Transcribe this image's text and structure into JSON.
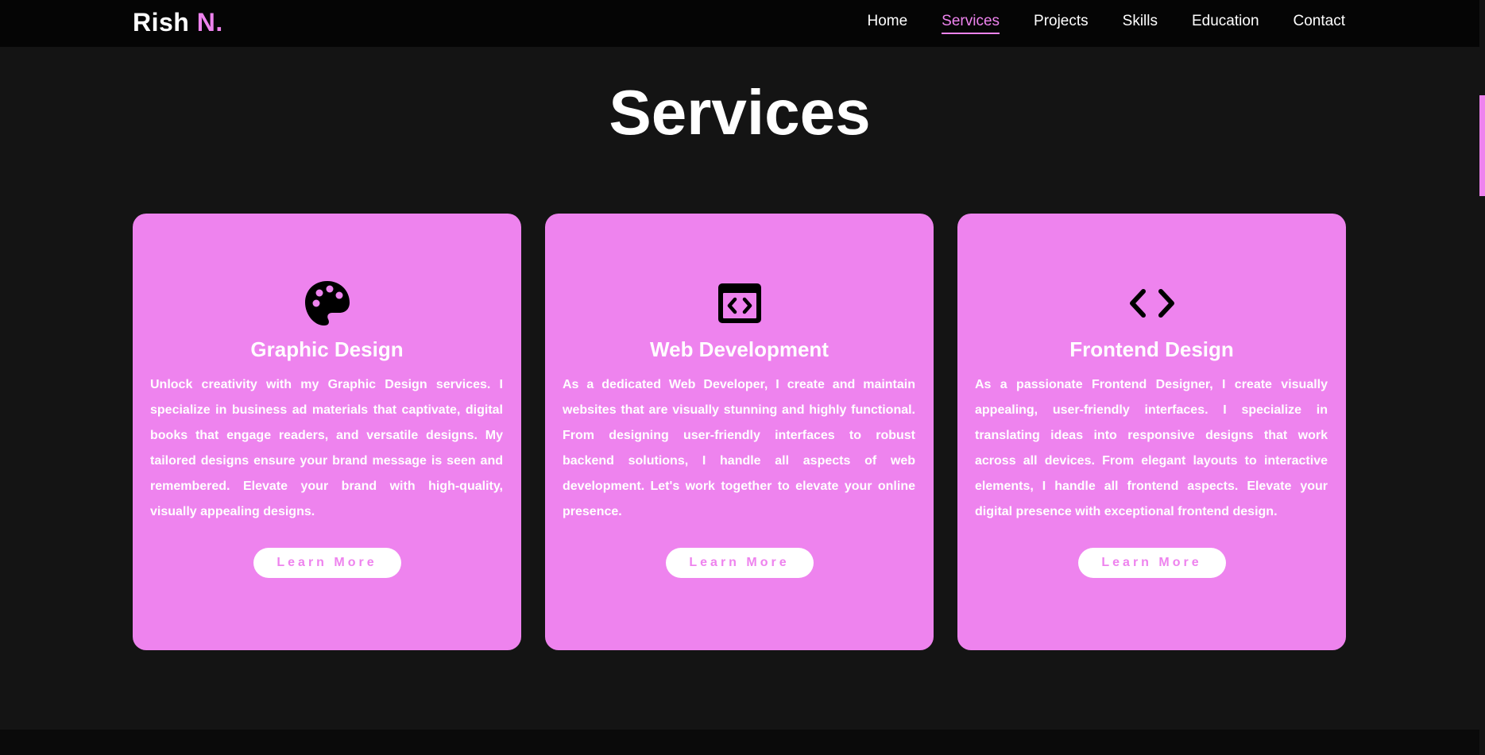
{
  "brand": {
    "name": "Rish",
    "accent": "N.",
    "accent_color": "#ee83ee"
  },
  "nav": {
    "items": [
      {
        "label": "Home",
        "active": false
      },
      {
        "label": "Services",
        "active": true
      },
      {
        "label": "Projects",
        "active": false
      },
      {
        "label": "Skills",
        "active": false
      },
      {
        "label": "Education",
        "active": false
      },
      {
        "label": "Contact",
        "active": false
      }
    ]
  },
  "section": {
    "title": "Services"
  },
  "cards": [
    {
      "icon": "palette-icon",
      "title": "Graphic Design",
      "text": "Unlock creativity with my Graphic Design services. I specialize in business ad materials that captivate, digital books that engage readers, and versatile designs. My tailored designs ensure your brand message is seen and remembered. Elevate your brand with high-quality, visually appealing designs.",
      "button": "Learn More"
    },
    {
      "icon": "code-window-icon",
      "title": "Web Development",
      "text": "As a dedicated Web Developer, I create and maintain websites that are visually stunning and highly functional. From designing user-friendly interfaces to robust backend solutions, I handle all aspects of web development. Let's work together to elevate your online presence.",
      "button": "Learn More"
    },
    {
      "icon": "code-brackets-icon",
      "title": "Frontend Design",
      "text": "As a passionate Frontend Designer, I create visually appealing, user-friendly interfaces. I specialize in translating ideas into responsive designs that work across all devices. From elegant layouts to interactive elements, I handle all frontend aspects. Elevate your digital presence with exceptional frontend design.",
      "button": "Learn More"
    }
  ],
  "colors": {
    "background": "#141414",
    "navbar": "#050505",
    "card": "#ee83ee",
    "accent": "#ee83ee"
  }
}
